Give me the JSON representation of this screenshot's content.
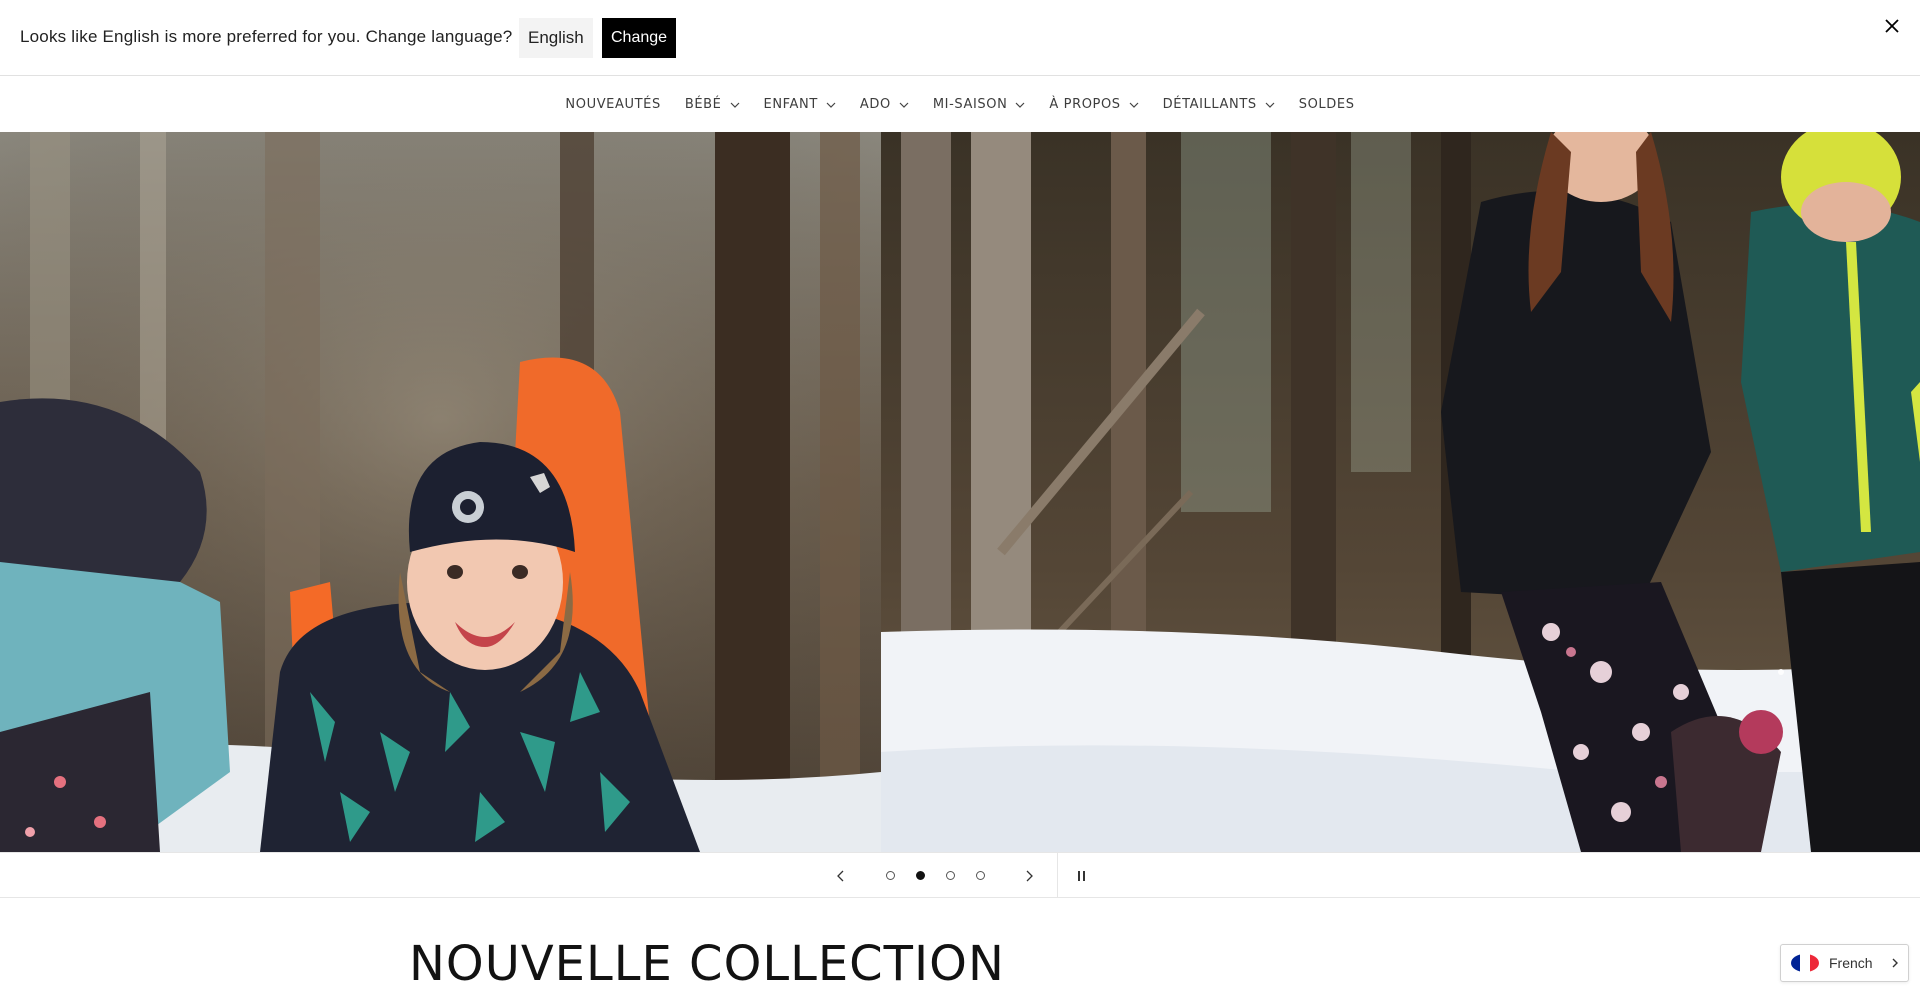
{
  "banner": {
    "message": "Looks like English is more preferred for you. Change language?",
    "english_label": "English",
    "change_label": "Change",
    "close_icon": "close-icon"
  },
  "nav": {
    "items": [
      {
        "label": "NOUVEAUTÉS",
        "dropdown": false
      },
      {
        "label": "BÉBÉ",
        "dropdown": true
      },
      {
        "label": "ENFANT",
        "dropdown": true
      },
      {
        "label": "ADO",
        "dropdown": true
      },
      {
        "label": "MI-SAISON",
        "dropdown": true
      },
      {
        "label": "À PROPOS",
        "dropdown": true
      },
      {
        "label": "DÉTAILLANTS",
        "dropdown": true
      },
      {
        "label": "SOLDES",
        "dropdown": false
      }
    ]
  },
  "slider": {
    "slide_count": 4,
    "active_slide": 2,
    "prev_icon": "chevron-left-icon",
    "next_icon": "chevron-right-icon",
    "pause_icon": "pause-icon"
  },
  "section": {
    "title": "NOUVELLE COLLECTION"
  },
  "language_widget": {
    "label": "French",
    "flag_colors": [
      "#002395",
      "#ffffff",
      "#ed2939"
    ]
  },
  "colors": {
    "text": "#121212",
    "button_dark": "#000000",
    "button_light": "#f3f3f3"
  }
}
